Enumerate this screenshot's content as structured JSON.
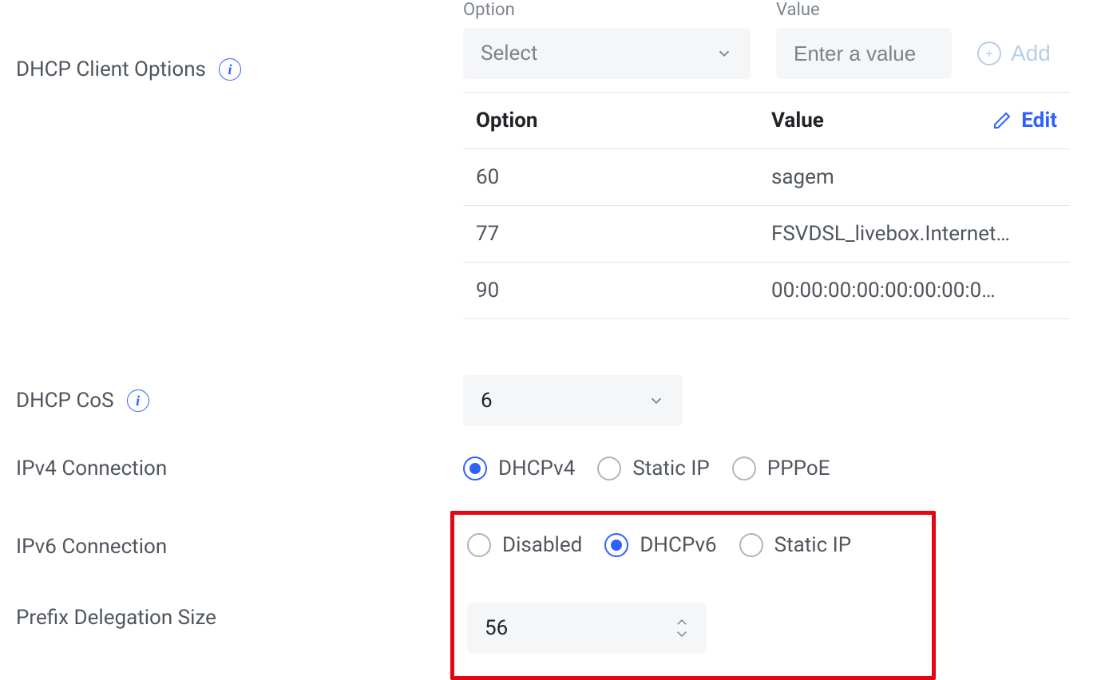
{
  "dhcp_client_options": {
    "label": "DHCP Client Options",
    "option_field_label": "Option",
    "value_field_label": "Value",
    "option_placeholder": "Select",
    "value_placeholder": "Enter a value",
    "add_label": "Add",
    "table": {
      "header_option": "Option",
      "header_value": "Value",
      "edit_label": "Edit",
      "rows": [
        {
          "option": "60",
          "value": "sagem"
        },
        {
          "option": "77",
          "value": "FSVDSL_livebox.Internet…"
        },
        {
          "option": "90",
          "value": "00:00:00:00:00:00:00:0…"
        }
      ]
    }
  },
  "dhcp_cos": {
    "label": "DHCP CoS",
    "value": "6"
  },
  "ipv4_connection": {
    "label": "IPv4 Connection",
    "options": {
      "dhcpv4": "DHCPv4",
      "static_ip": "Static IP",
      "pppoe": "PPPoE"
    },
    "selected": "dhcpv4"
  },
  "ipv6_connection": {
    "label": "IPv6 Connection",
    "options": {
      "disabled": "Disabled",
      "dhcpv6": "DHCPv6",
      "static_ip": "Static IP"
    },
    "selected": "dhcpv6"
  },
  "prefix_delegation": {
    "label": "Prefix Delegation Size",
    "value": "56"
  }
}
